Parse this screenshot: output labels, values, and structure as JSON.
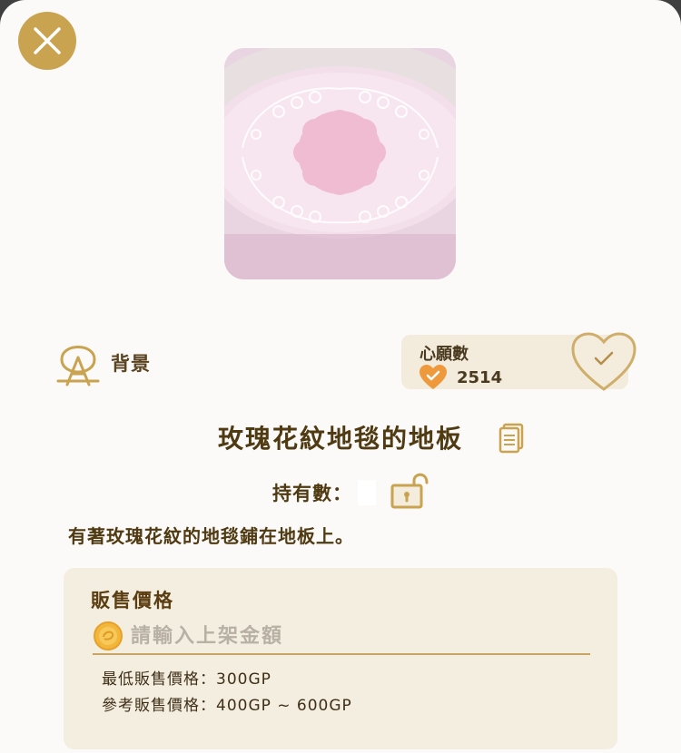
{
  "close": {
    "icon": "close-icon"
  },
  "item": {
    "name": "玫瑰花紋地毯的地板",
    "category": "背景",
    "description": "有著玫瑰花紋的地毯鋪在地板上。",
    "owned_label": "持有數："
  },
  "wishlist": {
    "title": "心願數",
    "count": "2514"
  },
  "sale": {
    "title": "販售價格",
    "placeholder": "請輸入上架金額",
    "min_price": "最低販售價格：300GP",
    "reference_price": "參考販售價格：400GP ~ 600GP"
  },
  "colors": {
    "accent_gold": "#c9a34f",
    "heart_orange": "#ee9a3c",
    "text_brown": "#4f3a12"
  }
}
